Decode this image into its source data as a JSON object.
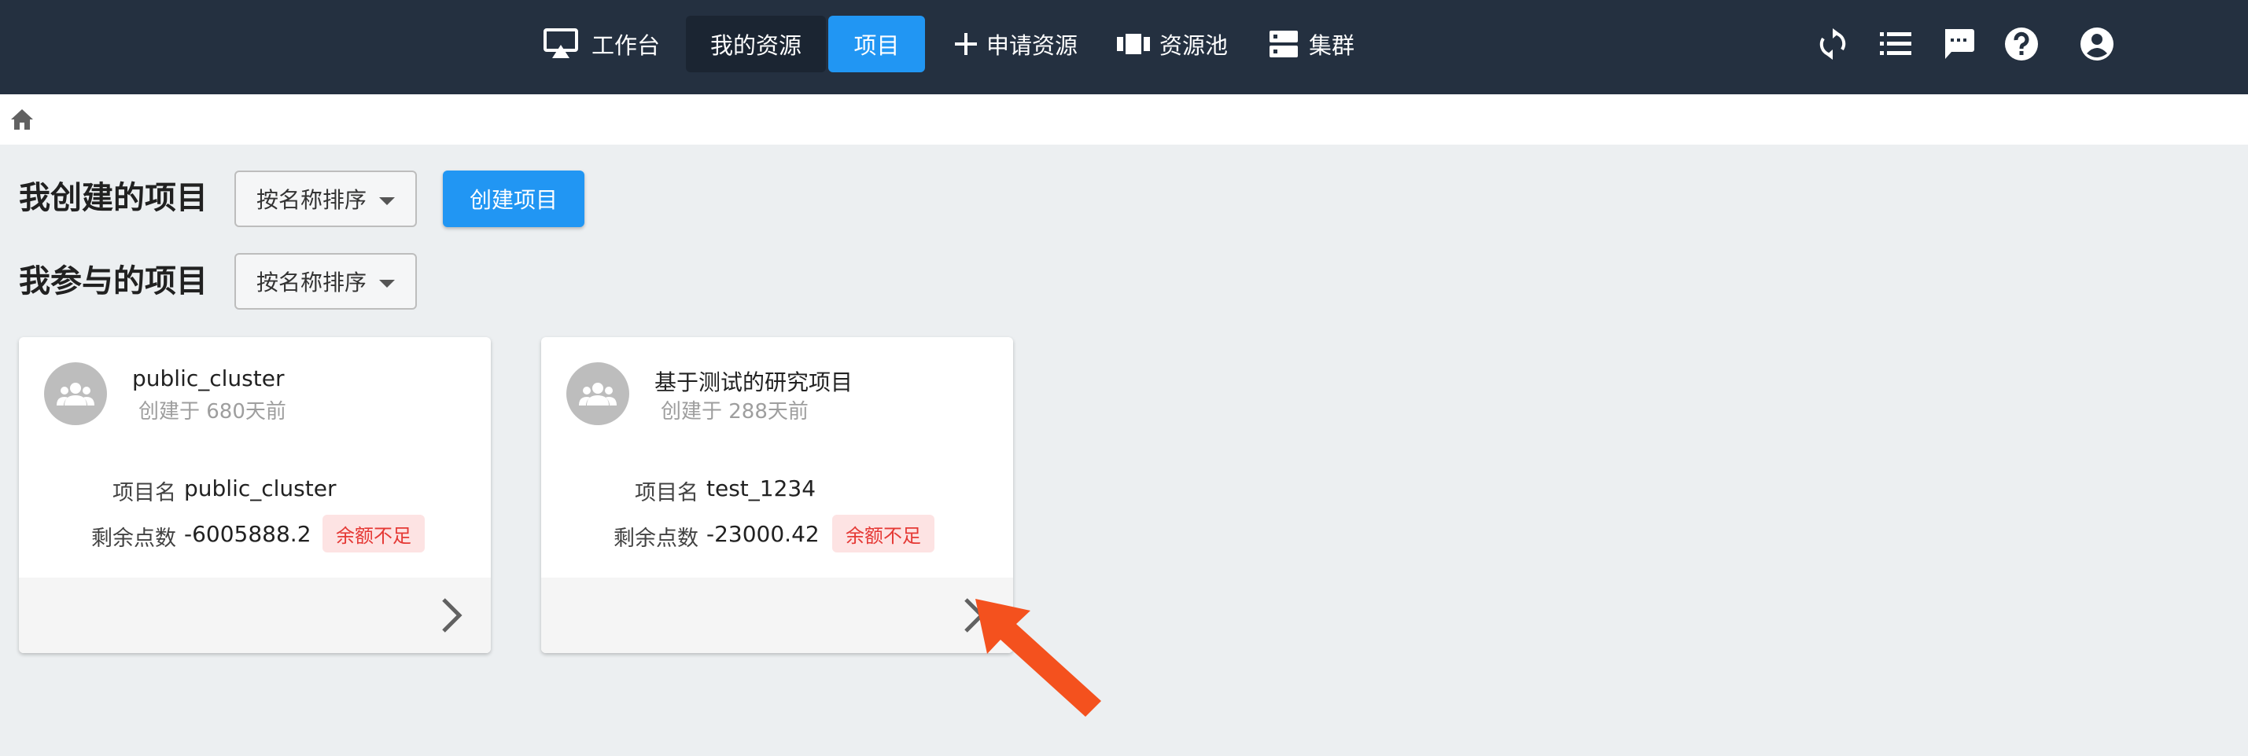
{
  "nav": {
    "items": [
      {
        "label": "工作台",
        "icon": "monitor-icon"
      },
      {
        "label": "我的资源",
        "icon": ""
      },
      {
        "label": "项目",
        "icon": ""
      },
      {
        "label": "申请资源",
        "icon": "plus-icon"
      },
      {
        "label": "资源池",
        "icon": "pool-icon"
      },
      {
        "label": "集群",
        "icon": "server-icon"
      }
    ],
    "right_icons": [
      "refresh-icon",
      "list-icon",
      "message-icon",
      "help-icon",
      "account-icon"
    ],
    "colors": {
      "bar": "#243040",
      "active": "#2196f3"
    }
  },
  "breadcrumb": {
    "icon": "home-icon"
  },
  "my_created": {
    "title": "我创建的项目",
    "sort_label": "按名称排序",
    "create_label": "创建项目"
  },
  "my_joined": {
    "title": "我参与的项目",
    "sort_label": "按名称排序"
  },
  "projects": [
    {
      "name": "public_cluster",
      "created": "创建于 680天前",
      "project_name_label": "项目名",
      "project_name": "public_cluster",
      "points_label": "剩余点数",
      "points": "-6005888.2",
      "badge": "余额不足"
    },
    {
      "name": "基于测试的研究项目",
      "created": "创建于 288天前",
      "project_name_label": "项目名",
      "project_name": "test_1234",
      "points_label": "剩余点数",
      "points": "-23000.42",
      "badge": "余额不足"
    }
  ],
  "badge_colors": {
    "bg": "#fde3e3",
    "text": "#e53935"
  },
  "annotation": {
    "color": "#f4511e",
    "icon": "red-arrow-icon"
  }
}
